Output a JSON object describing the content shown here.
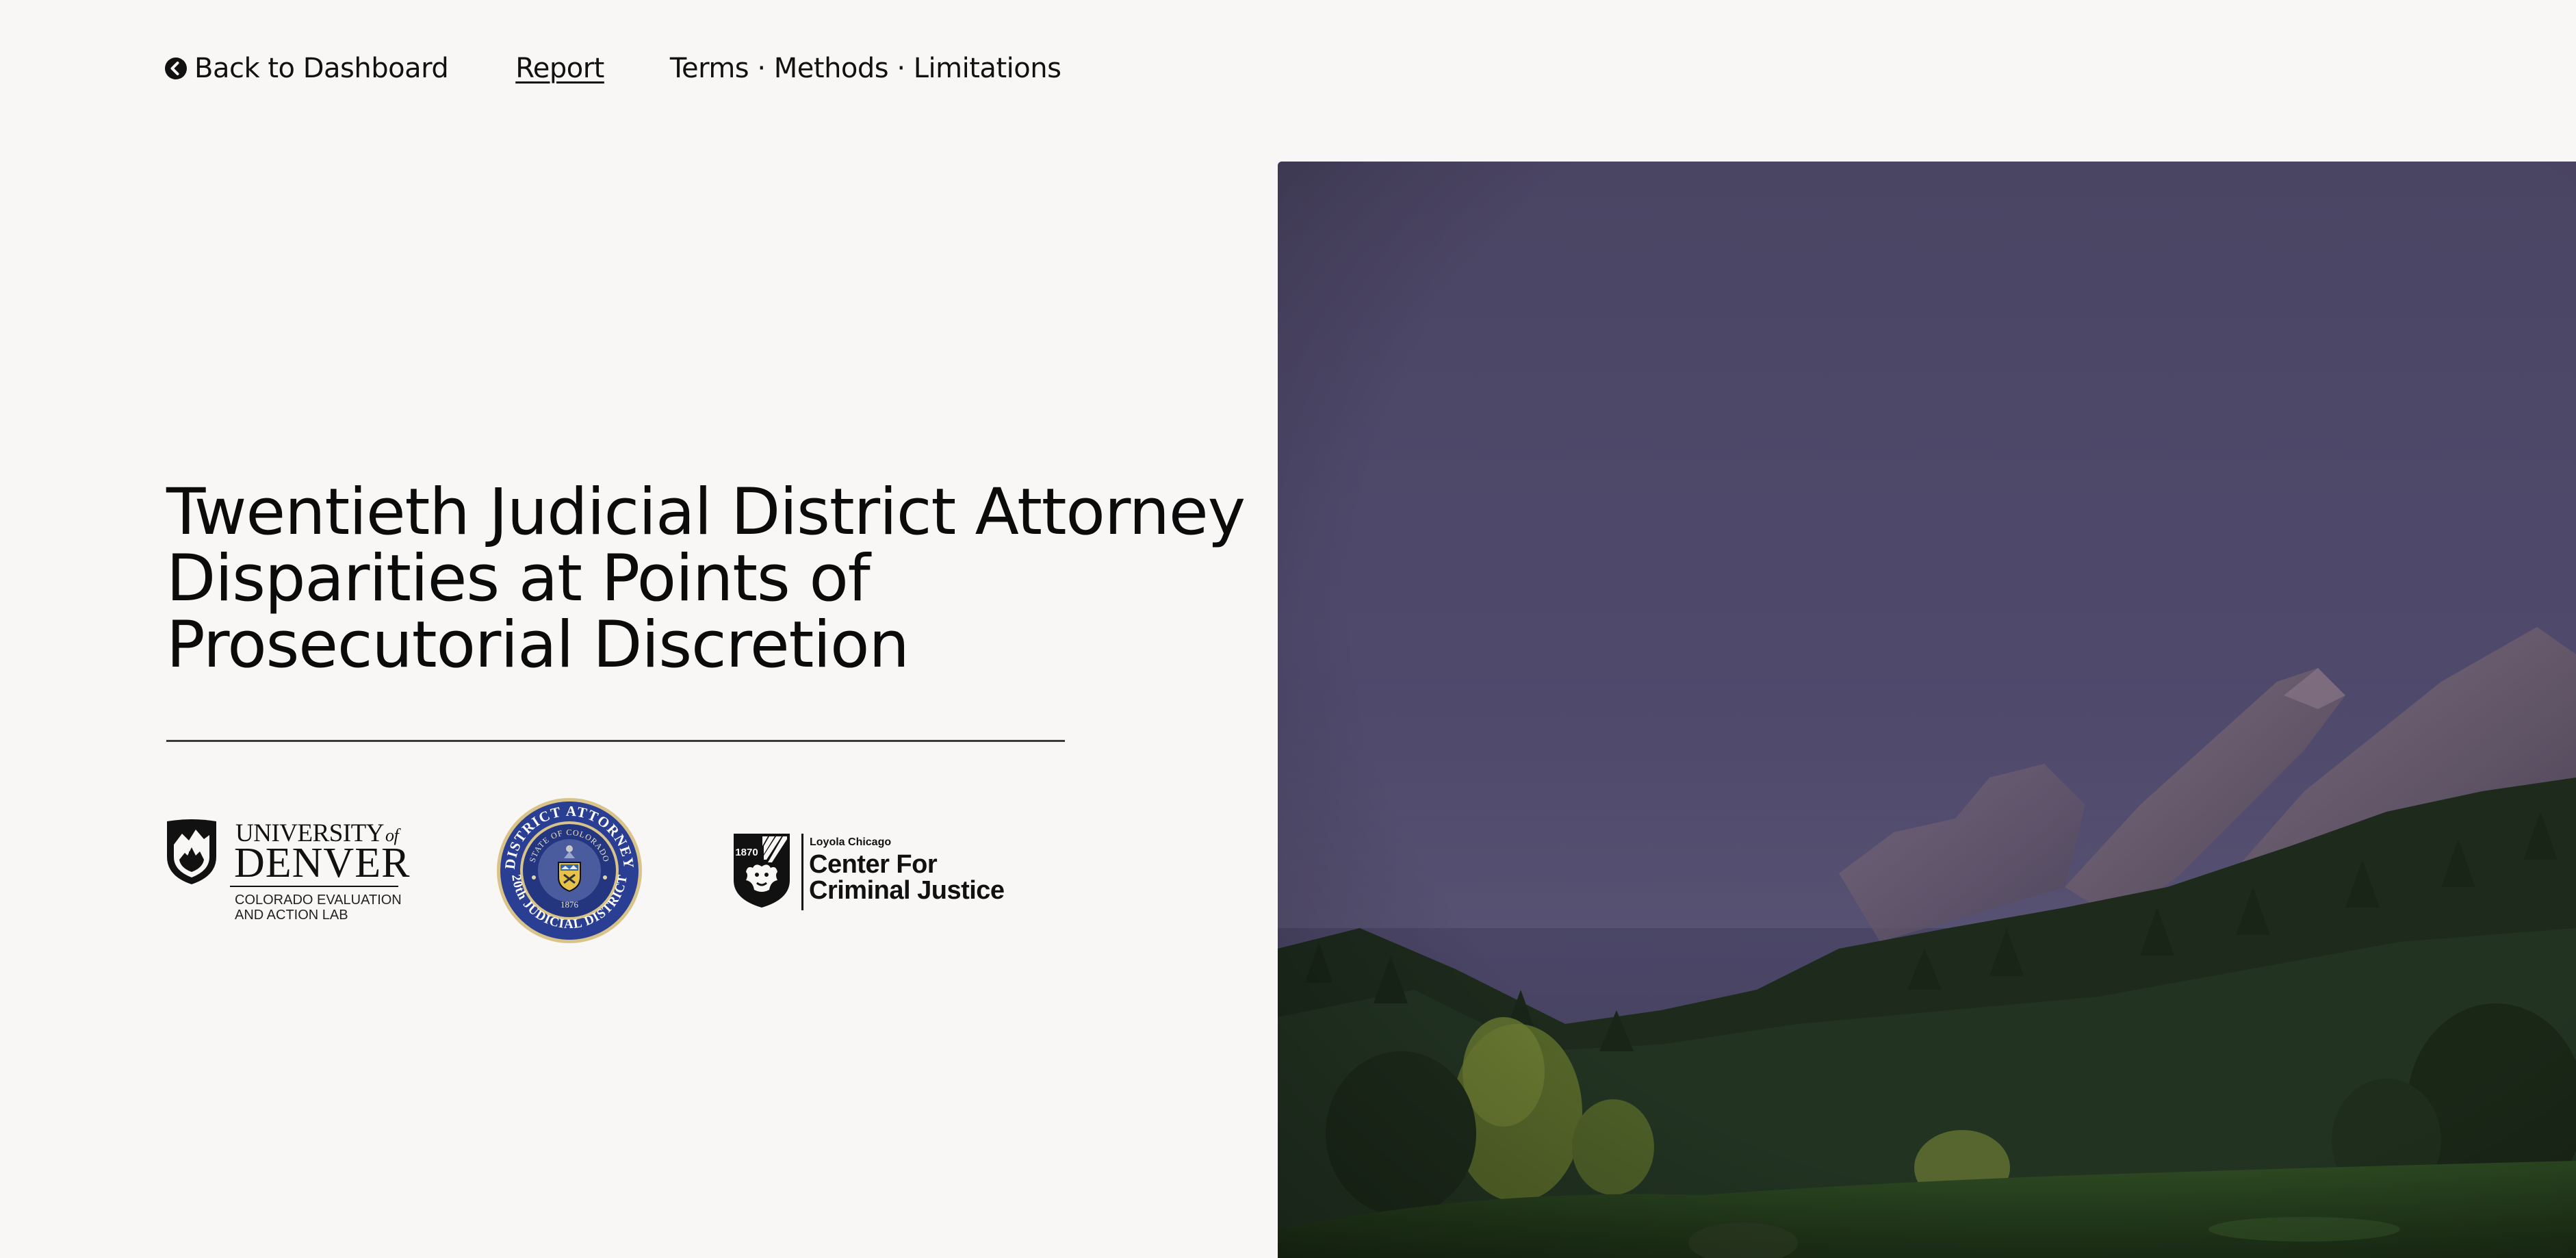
{
  "nav": {
    "back_label": "Back to Dashboard",
    "back_icon": "arrow-circle-left-icon",
    "report_label": "Report",
    "terms_label": "Terms · Methods · Limitations"
  },
  "hero": {
    "title_lines": [
      "Twentieth Judicial District Attorney",
      "Disparities at Points of",
      "Prosecutorial Discretion"
    ]
  },
  "logos": {
    "du": {
      "line1": "UNIVERSITY",
      "line1_suffix": "of",
      "line2": "DENVER",
      "sub1": "COLORADO EVALUATION",
      "sub2": "AND ACTION LAB"
    },
    "seal": {
      "top_text": "DISTRICT ATTORNEY",
      "inner_text": "STATE OF COLORADO",
      "bottom_text": "20th JUDICIAL DISTRICT",
      "year": "1876"
    },
    "ccj": {
      "year": "1870",
      "small": "Loyola Chicago",
      "line1": "Center For",
      "line2": "Criminal Justice"
    }
  },
  "colors": {
    "background": "#f8f7f5",
    "text": "#0d0d0d",
    "seal_blue": "#2a3f93",
    "seal_gold": "#d8c489",
    "sky": "#4e4868"
  }
}
